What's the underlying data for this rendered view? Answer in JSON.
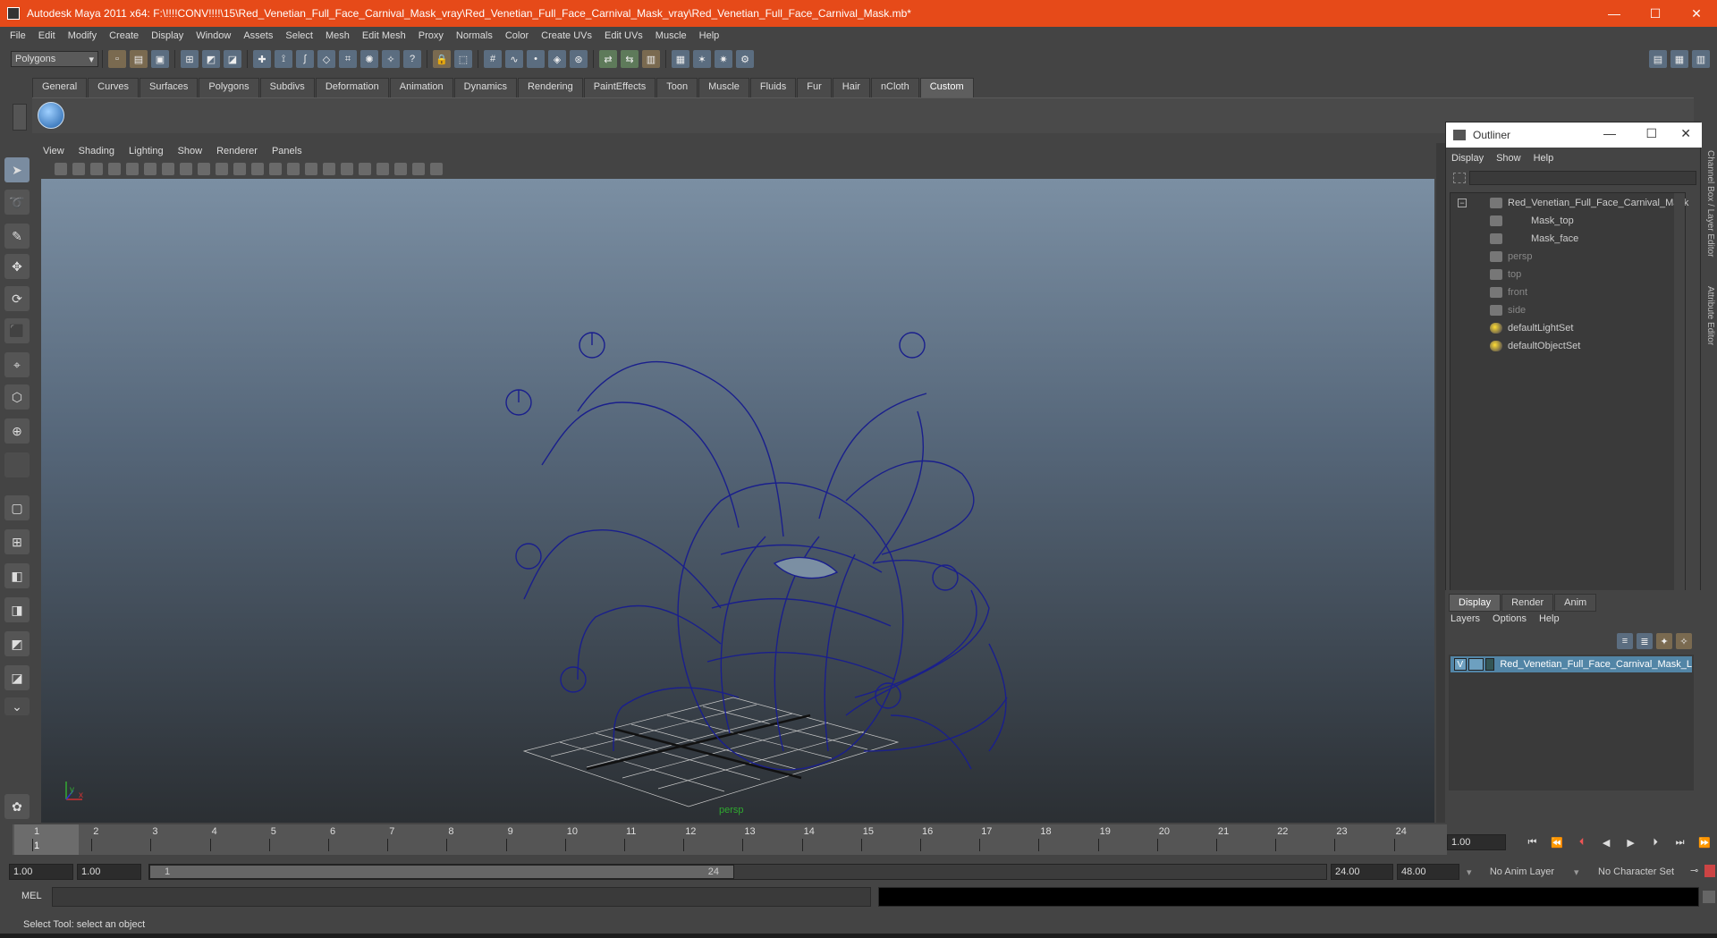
{
  "window": {
    "title": "Autodesk Maya 2011 x64: F:\\!!!!CONV!!!!\\15\\Red_Venetian_Full_Face_Carnival_Mask_vray\\Red_Venetian_Full_Face_Carnival_Mask_vray\\Red_Venetian_Full_Face_Carnival_Mask.mb*",
    "minimize": "—",
    "maximize": "☐",
    "close": "✕"
  },
  "menubar": [
    "File",
    "Edit",
    "Modify",
    "Create",
    "Display",
    "Window",
    "Assets",
    "Select",
    "Mesh",
    "Edit Mesh",
    "Proxy",
    "Normals",
    "Color",
    "Create UVs",
    "Edit UVs",
    "Muscle",
    "Help"
  ],
  "statusline": {
    "mode": "Polygons"
  },
  "shelf": {
    "tabs": [
      "General",
      "Curves",
      "Surfaces",
      "Polygons",
      "Subdivs",
      "Deformation",
      "Animation",
      "Dynamics",
      "Rendering",
      "PaintEffects",
      "Toon",
      "Muscle",
      "Fluids",
      "Fur",
      "Hair",
      "nCloth",
      "Custom"
    ],
    "active": "Custom"
  },
  "viewport": {
    "menus": [
      "View",
      "Shading",
      "Lighting",
      "Show",
      "Renderer",
      "Panels"
    ],
    "camera_label": "persp",
    "axis_x": "x",
    "axis_y": "y"
  },
  "outliner": {
    "title": "Outliner",
    "menus": [
      "Display",
      "Show",
      "Help"
    ],
    "items": [
      {
        "label": "Red_Venetian_Full_Face_Carnival_Mask",
        "depth": 0,
        "dim": false,
        "icon": "group-icon"
      },
      {
        "label": "Mask_top",
        "depth": 1,
        "dim": false,
        "icon": "mesh-icon"
      },
      {
        "label": "Mask_face",
        "depth": 1,
        "dim": false,
        "icon": "mesh-icon"
      },
      {
        "label": "persp",
        "depth": 0,
        "dim": true,
        "icon": "camera-icon"
      },
      {
        "label": "top",
        "depth": 0,
        "dim": true,
        "icon": "camera-icon"
      },
      {
        "label": "front",
        "depth": 0,
        "dim": true,
        "icon": "camera-icon"
      },
      {
        "label": "side",
        "depth": 0,
        "dim": true,
        "icon": "camera-icon"
      },
      {
        "label": "defaultLightSet",
        "depth": 0,
        "dim": false,
        "icon": "set-icon"
      },
      {
        "label": "defaultObjectSet",
        "depth": 0,
        "dim": false,
        "icon": "set-icon"
      }
    ]
  },
  "side_tabs": [
    "Channel Box / Layer Editor",
    "Attribute Editor"
  ],
  "layer_editor": {
    "tabs": [
      "Display",
      "Render",
      "Anim"
    ],
    "active": "Display",
    "menus": [
      "Layers",
      "Options",
      "Help"
    ],
    "layer": {
      "visible": "V",
      "name": "Red_Venetian_Full_Face_Carnival_Mask_L"
    }
  },
  "timeline": {
    "ticks": [
      "1",
      "2",
      "3",
      "4",
      "5",
      "6",
      "7",
      "8",
      "9",
      "10",
      "11",
      "12",
      "13",
      "14",
      "15",
      "16",
      "17",
      "18",
      "19",
      "20",
      "21",
      "22",
      "23",
      "24"
    ],
    "current_frame": "1",
    "current_time_field": "1.00"
  },
  "range": {
    "start": "1.00",
    "playback_start": "1.00",
    "handle_start": "1",
    "handle_end": "24",
    "playback_end": "24.00",
    "end": "48.00",
    "anim_layer": "No Anim Layer",
    "character_set": "No Character Set"
  },
  "command_line": {
    "label": "MEL"
  },
  "help_line": "Select Tool: select an object"
}
